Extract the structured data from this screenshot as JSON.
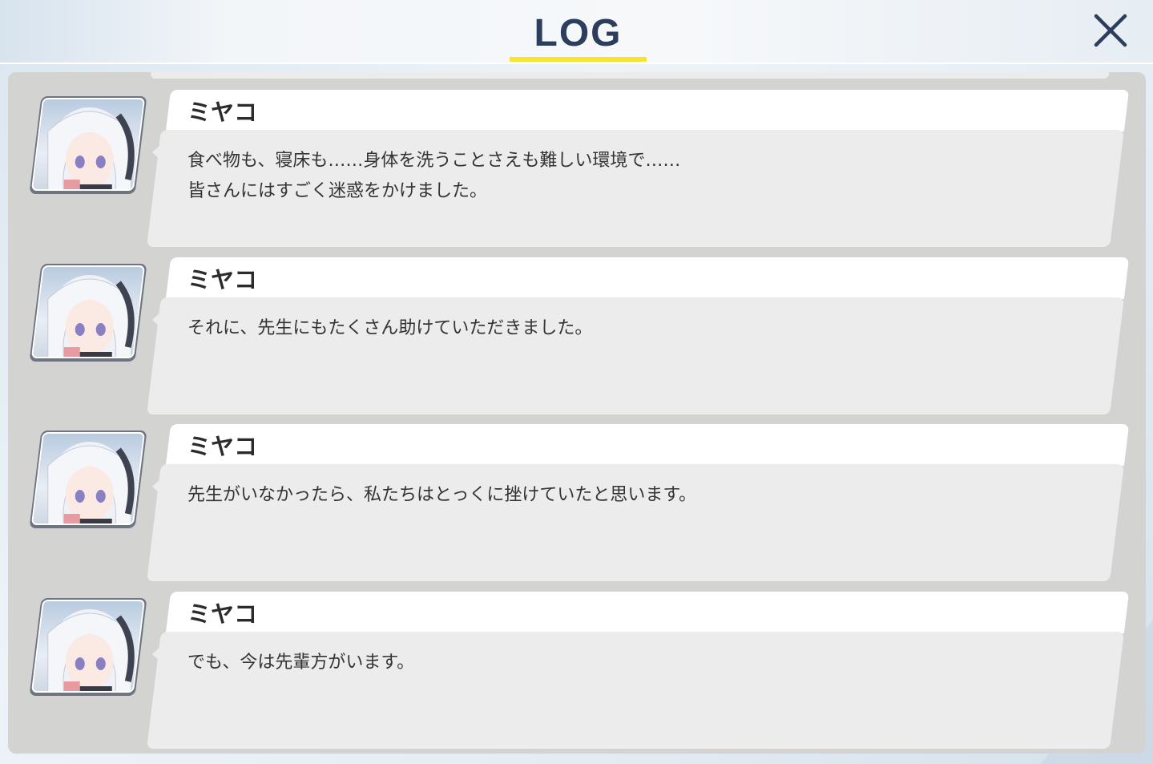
{
  "header": {
    "title": "LOG",
    "accent_color": "#f5e430",
    "title_color": "#2c3e5c"
  },
  "close": {
    "icon": "close-icon"
  },
  "entries": [
    {
      "avatar": "character-portrait",
      "name": "ミヤコ",
      "text": "食べ物も、寝床も……身体を洗うことさえも難しい環境で……\n皆さんにはすごく迷惑をかけました。"
    },
    {
      "avatar": "character-portrait",
      "name": "ミヤコ",
      "text": "それに、先生にもたくさん助けていただきました。"
    },
    {
      "avatar": "character-portrait",
      "name": "ミヤコ",
      "text": "先生がいなかったら、私たちはとっくに挫けていたと思います。"
    },
    {
      "avatar": "character-portrait",
      "name": "ミヤコ",
      "text": "でも、今は先輩方がいます。"
    }
  ]
}
